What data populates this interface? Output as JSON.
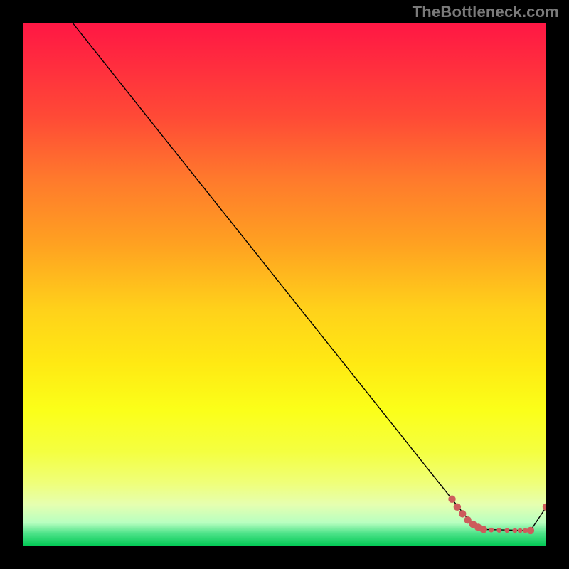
{
  "watermark": "TheBottleneck.com",
  "chart_data": {
    "type": "line",
    "title": "",
    "xlabel": "",
    "ylabel": "",
    "xlim": [
      0,
      100
    ],
    "ylim": [
      0,
      100
    ],
    "grid": false,
    "legend": false,
    "series": [
      {
        "name": "curve",
        "color": "#000000",
        "stroke_width": 1.4,
        "points": [
          {
            "x": 9.5,
            "y": 100
          },
          {
            "x": 27,
            "y": 78
          },
          {
            "x": 82,
            "y": 9
          },
          {
            "x": 86,
            "y": 4
          },
          {
            "x": 88,
            "y": 3.2
          },
          {
            "x": 97,
            "y": 3.0
          },
          {
            "x": 100,
            "y": 7.5
          }
        ]
      },
      {
        "name": "dots",
        "color": "#cd5c5c",
        "marker_radius_large": 5.2,
        "marker_radius_small": 3.4,
        "points": [
          {
            "x": 82.0,
            "y": 9.0,
            "r": "lg"
          },
          {
            "x": 83.0,
            "y": 7.5,
            "r": "lg"
          },
          {
            "x": 84.0,
            "y": 6.2,
            "r": "lg"
          },
          {
            "x": 85.0,
            "y": 5.0,
            "r": "lg"
          },
          {
            "x": 86.0,
            "y": 4.2,
            "r": "lg"
          },
          {
            "x": 87.0,
            "y": 3.6,
            "r": "lg"
          },
          {
            "x": 88.0,
            "y": 3.2,
            "r": "lg"
          },
          {
            "x": 89.5,
            "y": 3.1,
            "r": "sm"
          },
          {
            "x": 91.0,
            "y": 3.05,
            "r": "sm"
          },
          {
            "x": 92.5,
            "y": 3.02,
            "r": "sm"
          },
          {
            "x": 94.0,
            "y": 3.0,
            "r": "sm"
          },
          {
            "x": 95.0,
            "y": 3.0,
            "r": "sm"
          },
          {
            "x": 96.0,
            "y": 3.0,
            "r": "sm"
          },
          {
            "x": 97.0,
            "y": 3.0,
            "r": "lg"
          },
          {
            "x": 100.0,
            "y": 7.5,
            "r": "lg"
          }
        ]
      }
    ],
    "gradient_stops": [
      {
        "offset": 0.0,
        "color": "#ff1744"
      },
      {
        "offset": 0.07,
        "color": "#ff2a3f"
      },
      {
        "offset": 0.18,
        "color": "#ff4a36"
      },
      {
        "offset": 0.3,
        "color": "#ff7a2c"
      },
      {
        "offset": 0.42,
        "color": "#ffa021"
      },
      {
        "offset": 0.55,
        "color": "#ffd21a"
      },
      {
        "offset": 0.65,
        "color": "#ffe913"
      },
      {
        "offset": 0.74,
        "color": "#fbff19"
      },
      {
        "offset": 0.82,
        "color": "#f4ff41"
      },
      {
        "offset": 0.88,
        "color": "#efff7a"
      },
      {
        "offset": 0.92,
        "color": "#e6ffb0"
      },
      {
        "offset": 0.955,
        "color": "#b8ffc0"
      },
      {
        "offset": 0.975,
        "color": "#4fe38a"
      },
      {
        "offset": 1.0,
        "color": "#00c853"
      }
    ]
  }
}
